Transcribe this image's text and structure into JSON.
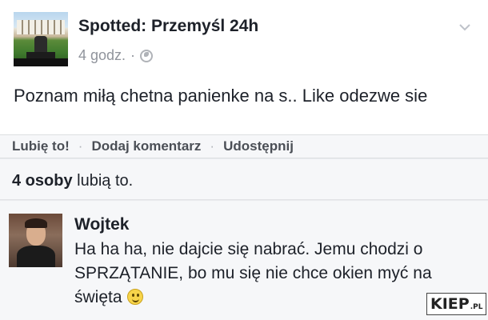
{
  "post": {
    "page_name": "Spotted: Przemyśl 24h",
    "time": "4 godz.",
    "separator": "·",
    "text": "Poznam miłą chetna panienke na s.. Like odezwe sie"
  },
  "actions": {
    "like": "Lubię to!",
    "comment": "Dodaj komentarz",
    "share": "Udostępnij",
    "separator": "·"
  },
  "likes": {
    "count": "4 osoby",
    "suffix": " lubią to."
  },
  "comment": {
    "author": "Wojtek",
    "text": "Ha ha ha, nie dajcie się nabrać. Jemu chodzi o SPRZĄTANIE, bo mu się nie chce okien myć na święta"
  },
  "watermark": {
    "main": "KIEP",
    "suffix": ".PL"
  },
  "icons": {
    "privacy": "globe-icon",
    "menu": "chevron-down-icon",
    "emoji": "smiley-icon"
  }
}
